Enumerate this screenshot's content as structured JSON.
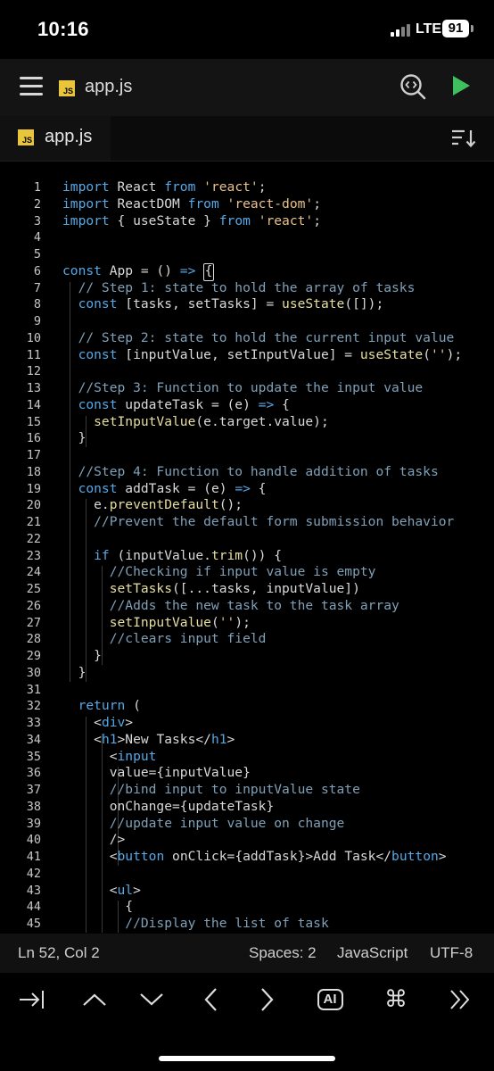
{
  "colors": {
    "keyword": "#56a8e6",
    "string": "#e8c28a",
    "comment": "#7fa0b8",
    "function": "#e7df9f",
    "tag": "#56a8e6",
    "text": "#d9d9d9",
    "run": "#3fbf5f",
    "js_badge": "#e8c53a"
  },
  "status_bar": {
    "time": "10:16",
    "network": "LTE",
    "battery": "91"
  },
  "toolbar": {
    "badge": "JS",
    "title": "app.js",
    "icons": [
      "menu-icon",
      "search-code-icon",
      "run-icon"
    ]
  },
  "tabs": [
    {
      "badge": "JS",
      "title": "app.js"
    }
  ],
  "editor": {
    "lines": [
      {
        "n": "1",
        "t": [
          [
            "import ",
            "keyword"
          ],
          [
            "React ",
            "text"
          ],
          [
            "from ",
            "keyword"
          ],
          [
            "'react'",
            "string"
          ],
          [
            ";",
            "text"
          ]
        ]
      },
      {
        "n": "2",
        "t": [
          [
            "import ",
            "keyword"
          ],
          [
            "ReactDOM ",
            "text"
          ],
          [
            "from ",
            "keyword"
          ],
          [
            "'react-dom'",
            "string"
          ],
          [
            ";",
            "text"
          ]
        ]
      },
      {
        "n": "3",
        "t": [
          [
            "import ",
            "keyword"
          ],
          [
            "{ useState } ",
            "text"
          ],
          [
            "from ",
            "keyword"
          ],
          [
            "'react'",
            "string"
          ],
          [
            ";",
            "text"
          ]
        ]
      },
      {
        "n": "4",
        "t": []
      },
      {
        "n": "5",
        "t": []
      },
      {
        "n": "6",
        "t": [
          [
            "const ",
            "keyword"
          ],
          [
            "App = () ",
            "text"
          ],
          [
            "=> ",
            "keyword"
          ]
        ]
      },
      {
        "n": "7",
        "t": [
          [
            "  // Step 1: state to hold the array of tasks",
            "comment"
          ]
        ]
      },
      {
        "n": "8",
        "t": [
          [
            "  const ",
            "keyword"
          ],
          [
            "[tasks, setTasks] = ",
            "text"
          ],
          [
            "useState",
            "function"
          ],
          [
            "([]);",
            "text"
          ]
        ]
      },
      {
        "n": "9",
        "t": []
      },
      {
        "n": "10",
        "t": [
          [
            "  // Step 2: state to hold the current input value",
            "comment"
          ]
        ]
      },
      {
        "n": "11",
        "t": [
          [
            "  const ",
            "keyword"
          ],
          [
            "[inputValue, setInputValue] = ",
            "text"
          ],
          [
            "useState",
            "function"
          ],
          [
            "(",
            "text"
          ],
          [
            "''",
            "string"
          ],
          [
            ");",
            "text"
          ]
        ]
      },
      {
        "n": "12",
        "t": []
      },
      {
        "n": "13",
        "t": [
          [
            "  //Step 3: Function to update the input value",
            "comment"
          ]
        ]
      },
      {
        "n": "14",
        "t": [
          [
            "  const ",
            "keyword"
          ],
          [
            "updateTask = (e) ",
            "text"
          ],
          [
            "=> ",
            "keyword"
          ],
          [
            "{",
            "text"
          ]
        ]
      },
      {
        "n": "15",
        "t": [
          [
            "    setInputValue",
            "function"
          ],
          [
            "(e.target.value);",
            "text"
          ]
        ]
      },
      {
        "n": "16",
        "t": [
          [
            "  }",
            "text"
          ]
        ]
      },
      {
        "n": "17",
        "t": []
      },
      {
        "n": "18",
        "t": [
          [
            "  //Step 4: Function to handle addition of tasks",
            "comment"
          ]
        ]
      },
      {
        "n": "19",
        "t": [
          [
            "  const ",
            "keyword"
          ],
          [
            "addTask = (e) ",
            "text"
          ],
          [
            "=> ",
            "keyword"
          ],
          [
            "{",
            "text"
          ]
        ]
      },
      {
        "n": "20",
        "t": [
          [
            "    e.",
            "text"
          ],
          [
            "preventDefault",
            "function"
          ],
          [
            "();",
            "text"
          ]
        ]
      },
      {
        "n": "21",
        "t": [
          [
            "    //Prevent the default form submission behavior",
            "comment"
          ]
        ]
      },
      {
        "n": "22",
        "t": []
      },
      {
        "n": "23",
        "t": [
          [
            "    if ",
            "keyword"
          ],
          [
            "(inputValue.",
            "text"
          ],
          [
            "trim",
            "function"
          ],
          [
            "()) {",
            "text"
          ]
        ]
      },
      {
        "n": "24",
        "t": [
          [
            "      //Checking if input value is empty",
            "comment"
          ]
        ]
      },
      {
        "n": "25",
        "t": [
          [
            "      setTasks",
            "function"
          ],
          [
            "([...tasks, inputValue])",
            "text"
          ]
        ]
      },
      {
        "n": "26",
        "t": [
          [
            "      //Adds the new task to the task array",
            "comment"
          ]
        ]
      },
      {
        "n": "27",
        "t": [
          [
            "      setInputValue",
            "function"
          ],
          [
            "(",
            "text"
          ],
          [
            "''",
            "string"
          ],
          [
            ");",
            "text"
          ]
        ]
      },
      {
        "n": "28",
        "t": [
          [
            "      //clears input field",
            "comment"
          ]
        ]
      },
      {
        "n": "29",
        "t": [
          [
            "    }",
            "text"
          ]
        ]
      },
      {
        "n": "30",
        "t": [
          [
            "  }",
            "text"
          ]
        ]
      },
      {
        "n": "31",
        "t": []
      },
      {
        "n": "32",
        "t": [
          [
            "  return ",
            "keyword"
          ],
          [
            "(",
            "text"
          ]
        ]
      },
      {
        "n": "33",
        "t": [
          [
            "    <",
            "text"
          ],
          [
            "div",
            "tag"
          ],
          [
            ">",
            "text"
          ]
        ]
      },
      {
        "n": "34",
        "t": [
          [
            "    <",
            "text"
          ],
          [
            "h1",
            "tag"
          ],
          [
            ">New Tasks</",
            "text"
          ],
          [
            "h1",
            "tag"
          ],
          [
            ">",
            "text"
          ]
        ]
      },
      {
        "n": "35",
        "t": [
          [
            "      <",
            "text"
          ],
          [
            "input",
            "tag"
          ]
        ]
      },
      {
        "n": "36",
        "t": [
          [
            "      value={inputValue}",
            "text"
          ]
        ]
      },
      {
        "n": "37",
        "t": [
          [
            "      //bind input to inputValue state",
            "comment"
          ]
        ]
      },
      {
        "n": "38",
        "t": [
          [
            "      onChange={updateTask}",
            "text"
          ]
        ]
      },
      {
        "n": "39",
        "t": [
          [
            "      //update input value on change",
            "comment"
          ]
        ]
      },
      {
        "n": "40",
        "t": [
          [
            "      />",
            "text"
          ]
        ]
      },
      {
        "n": "41",
        "t": [
          [
            "      <",
            "text"
          ],
          [
            "button ",
            "tag"
          ],
          [
            "onClick={addTask}>Add Task</",
            "text"
          ],
          [
            "button",
            "tag"
          ],
          [
            ">",
            "text"
          ]
        ]
      },
      {
        "n": "42",
        "t": []
      },
      {
        "n": "43",
        "t": [
          [
            "      <",
            "text"
          ],
          [
            "ul",
            "tag"
          ],
          [
            ">",
            "text"
          ]
        ]
      },
      {
        "n": "44",
        "t": [
          [
            "        {",
            "text"
          ]
        ]
      },
      {
        "n": "45",
        "t": [
          [
            "        //Display the list of task",
            "comment"
          ]
        ]
      }
    ],
    "cursor_char": "{"
  },
  "footer": {
    "position": "Ln 52, Col 2",
    "spaces": "Spaces: 2",
    "language": "JavaScript",
    "encoding": "UTF-8"
  },
  "keybar": [
    "tab-key",
    "up-arrow",
    "down-arrow",
    "left-arrow",
    "right-arrow",
    "ai-button",
    "command-key",
    "fast-forward"
  ],
  "keybar_ai_label": "AI"
}
